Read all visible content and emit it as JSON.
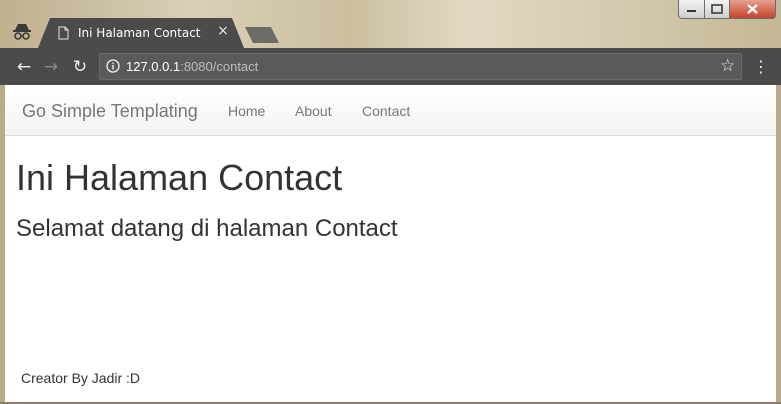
{
  "browser": {
    "tab_title": "Ini Halaman Contact",
    "tab_close": "×",
    "url_host": "127.0.0.1",
    "url_rest": ":8080/contact",
    "icons": {
      "incognito": "incognito-icon",
      "favicon": "document-icon",
      "back": "arrow-left-icon",
      "forward": "arrow-right-icon",
      "reload": "reload-icon",
      "info": "info-icon",
      "star": "star-icon",
      "menu": "kebab-menu-icon"
    },
    "glyphs": {
      "back": "←",
      "forward": "→",
      "reload": "↻",
      "star": "☆",
      "menu": "⋮"
    },
    "colors": {
      "toolbar": "#4b4b4b",
      "tab_active": "#4b4b4b",
      "close_button": "#c4432b"
    }
  },
  "navbar": {
    "brand": "Go Simple Templating",
    "links": [
      {
        "label": "Home"
      },
      {
        "label": "About"
      },
      {
        "label": "Contact"
      }
    ]
  },
  "main": {
    "title": "Ini Halaman Contact",
    "subtitle": "Selamat datang di halaman Contact"
  },
  "footer": {
    "text": "Creator By Jadir :D"
  }
}
